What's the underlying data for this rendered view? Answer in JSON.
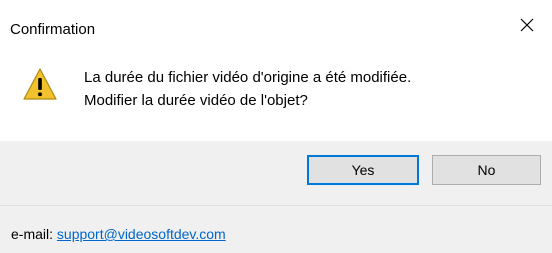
{
  "window": {
    "title": "Confirmation",
    "close_icon": "close-icon"
  },
  "message": {
    "icon": "warning-icon",
    "line1": "La durée du fichier vidéo d'origine a été modifiée.",
    "line2": "Modifier la durée vidéo de l'objet?"
  },
  "buttons": {
    "yes_label": "Yes",
    "no_label": "No",
    "default": "Yes"
  },
  "footer": {
    "email_label": "e-mail:",
    "email_link": "support@videosoftdev.com"
  },
  "colors": {
    "accent": "#0078d7",
    "link": "#0066cc",
    "panel": "#f0f0f0",
    "warning": "#f2c12e"
  }
}
